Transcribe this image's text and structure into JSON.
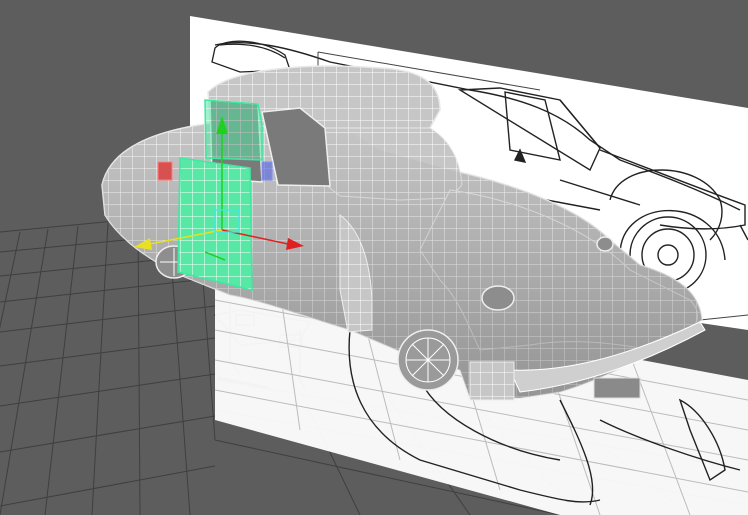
{
  "viewport": {
    "background_color": "#5d5d5d",
    "grid_line_color": "#3d3d3d",
    "reference_plane_color": "#ffffff",
    "blueprint_line_color": "#222222",
    "mesh_fill_color": "#c4c4c4",
    "mesh_wire_color": "#ffffff",
    "selection_color": "#40e8a0",
    "gizmo": {
      "x_axis_color": "#e02020",
      "y_axis_color": "#20d020",
      "z_axis_color": "#e8e020",
      "handle_red_color": "#d84040",
      "handle_blue_color": "#5060e0"
    }
  }
}
